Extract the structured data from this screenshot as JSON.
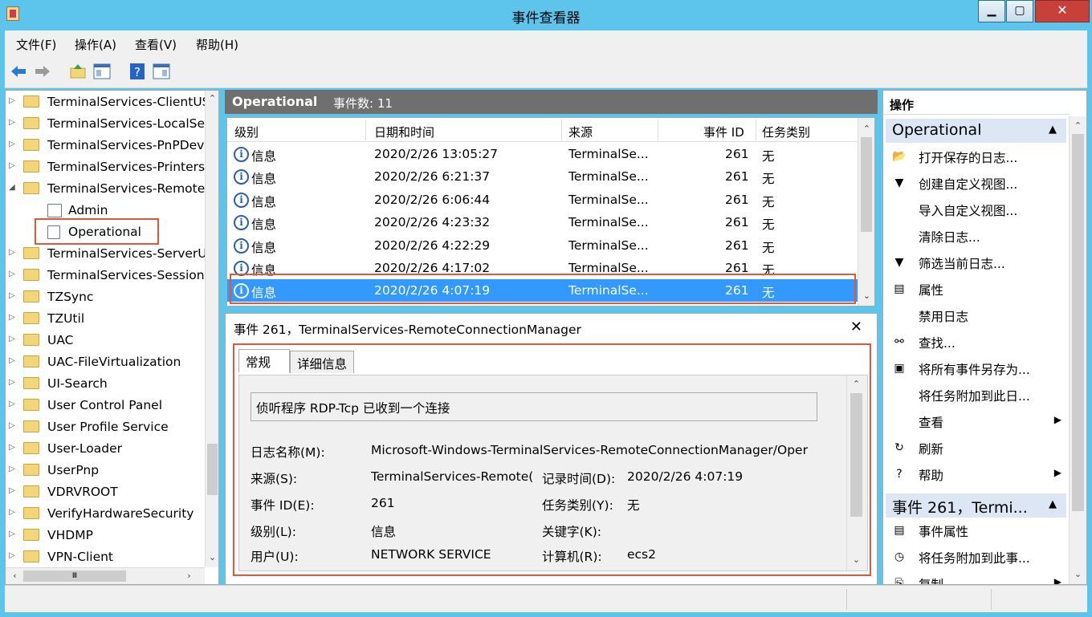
{
  "window": {
    "title": "事件查看器",
    "min": "▁",
    "max": "▢",
    "close": "✕"
  },
  "menu": [
    "文件(F)",
    "操作(A)",
    "查看(V)",
    "帮助(H)"
  ],
  "tree": {
    "items": [
      {
        "label": "TerminalServices-ClientUSBDevices",
        "expander": "▷",
        "icon": "folder"
      },
      {
        "label": "TerminalServices-LocalSessionManager",
        "expander": "▷",
        "icon": "folder"
      },
      {
        "label": "TerminalServices-PnPDevices",
        "expander": "▷",
        "icon": "folder"
      },
      {
        "label": "TerminalServices-Printers",
        "expander": "▷",
        "icon": "folder"
      },
      {
        "label": "TerminalServices-RemoteConnectionManager",
        "expander": "◢",
        "icon": "folder"
      },
      {
        "label": "Admin",
        "expander": "",
        "icon": "log"
      },
      {
        "label": "Operational",
        "expander": "",
        "icon": "log"
      },
      {
        "label": "TerminalServices-ServerUSBDevices",
        "expander": "▷",
        "icon": "folder"
      },
      {
        "label": "TerminalServices-SessionBroker",
        "expander": "▷",
        "icon": "folder"
      },
      {
        "label": "TZSync",
        "expander": "▷",
        "icon": "folder"
      },
      {
        "label": "TZUtil",
        "expander": "▷",
        "icon": "folder"
      },
      {
        "label": "UAC",
        "expander": "▷",
        "icon": "folder"
      },
      {
        "label": "UAC-FileVirtualization",
        "expander": "▷",
        "icon": "folder"
      },
      {
        "label": "UI-Search",
        "expander": "▷",
        "icon": "folder"
      },
      {
        "label": "User Control Panel",
        "expander": "▷",
        "icon": "folder"
      },
      {
        "label": "User Profile Service",
        "expander": "▷",
        "icon": "folder"
      },
      {
        "label": "User-Loader",
        "expander": "▷",
        "icon": "folder"
      },
      {
        "label": "UserPnp",
        "expander": "▷",
        "icon": "folder"
      },
      {
        "label": "VDRVROOT",
        "expander": "▷",
        "icon": "folder"
      },
      {
        "label": "VerifyHardwareSecurity",
        "expander": "▷",
        "icon": "folder"
      },
      {
        "label": "VHDMP",
        "expander": "▷",
        "icon": "folder"
      },
      {
        "label": "VPN-Client",
        "expander": "▷",
        "icon": "folder"
      }
    ],
    "scroll_mid": "Ⅲ"
  },
  "log_header": {
    "name": "Operational",
    "count": "事件数: 11"
  },
  "grid": {
    "columns": [
      "级别",
      "日期和时间",
      "来源",
      "事件 ID",
      "任务类别"
    ],
    "rows": [
      {
        "level": "信息",
        "datetime": "2020/2/26 13:05:27",
        "source": "TerminalSe...",
        "id": "261",
        "task": "无"
      },
      {
        "level": "信息",
        "datetime": "2020/2/26 6:21:37",
        "source": "TerminalSe...",
        "id": "261",
        "task": "无"
      },
      {
        "level": "信息",
        "datetime": "2020/2/26 6:06:44",
        "source": "TerminalSe...",
        "id": "261",
        "task": "无"
      },
      {
        "level": "信息",
        "datetime": "2020/2/26 4:23:32",
        "source": "TerminalSe...",
        "id": "261",
        "task": "无"
      },
      {
        "level": "信息",
        "datetime": "2020/2/26 4:22:29",
        "source": "TerminalSe...",
        "id": "261",
        "task": "无"
      },
      {
        "level": "信息",
        "datetime": "2020/2/26 4:17:02",
        "source": "TerminalSe...",
        "id": "261",
        "task": "无"
      },
      {
        "level": "信息",
        "datetime": "2020/2/26 4:07:19",
        "source": "TerminalSe...",
        "id": "261",
        "task": "无"
      }
    ],
    "selected_index": 6
  },
  "detail": {
    "title": "事件 261，TerminalServices-RemoteConnectionManager",
    "close": "✕",
    "tabs": [
      "常规",
      "详细信息"
    ],
    "message": "侦听程序 RDP-Tcp 已收到一个连接",
    "fields": {
      "log_name_label": "日志名称(M):",
      "log_name": "Microsoft-Windows-TerminalServices-RemoteConnectionManager/Oper",
      "source_label": "来源(S):",
      "source": "TerminalServices-Remote(",
      "logged_label": "记录时间(D):",
      "logged": "2020/2/26 4:07:19",
      "event_id_label": "事件 ID(E):",
      "event_id": "261",
      "task_label": "任务类别(Y):",
      "task": "无",
      "level_label": "级别(L):",
      "level": "信息",
      "keywords_label": "关键字(K):",
      "user_label": "用户(U):",
      "user": "NETWORK SERVICE",
      "computer_label": "计算机(R):",
      "computer": "ecs2"
    }
  },
  "actions": {
    "header": "操作",
    "section1": "Operational",
    "items1": [
      {
        "label": "打开保存的日志...",
        "icon": "open-folder-icon",
        "glyph": "📂"
      },
      {
        "label": "创建自定义视图...",
        "icon": "filter-icon",
        "glyph": "▼"
      },
      {
        "label": "导入自定义视图...",
        "icon": "",
        "glyph": ""
      },
      {
        "label": "清除日志...",
        "icon": "",
        "glyph": ""
      },
      {
        "label": "筛选当前日志...",
        "icon": "filter-icon",
        "glyph": "▼"
      },
      {
        "label": "属性",
        "icon": "properties-icon",
        "glyph": "▤"
      },
      {
        "label": "禁用日志",
        "icon": "",
        "glyph": ""
      },
      {
        "label": "查找...",
        "icon": "binoculars-icon",
        "glyph": "⚯"
      },
      {
        "label": "将所有事件另存为...",
        "icon": "save-icon",
        "glyph": "▣"
      },
      {
        "label": "将任务附加到此日...",
        "icon": "",
        "glyph": ""
      },
      {
        "label": "查看",
        "icon": "",
        "glyph": "",
        "submenu": "▶"
      },
      {
        "label": "刷新",
        "icon": "refresh-icon",
        "glyph": "↻"
      },
      {
        "label": "帮助",
        "icon": "help-icon",
        "glyph": "?",
        "submenu": "▶"
      }
    ],
    "section2": "事件 261，Termi...",
    "items2": [
      {
        "label": "事件属性",
        "icon": "properties-icon",
        "glyph": "▤"
      },
      {
        "label": "将任务附加到此事...",
        "icon": "clock-icon",
        "glyph": "◷"
      },
      {
        "label": "复制",
        "icon": "copy-icon",
        "glyph": "⎘",
        "submenu": "▶"
      }
    ]
  },
  "colors": {
    "titlebar": "#5dc4ec",
    "selection": "#3399ff",
    "highlight": "#e2563c",
    "section": "#dce6f4"
  }
}
